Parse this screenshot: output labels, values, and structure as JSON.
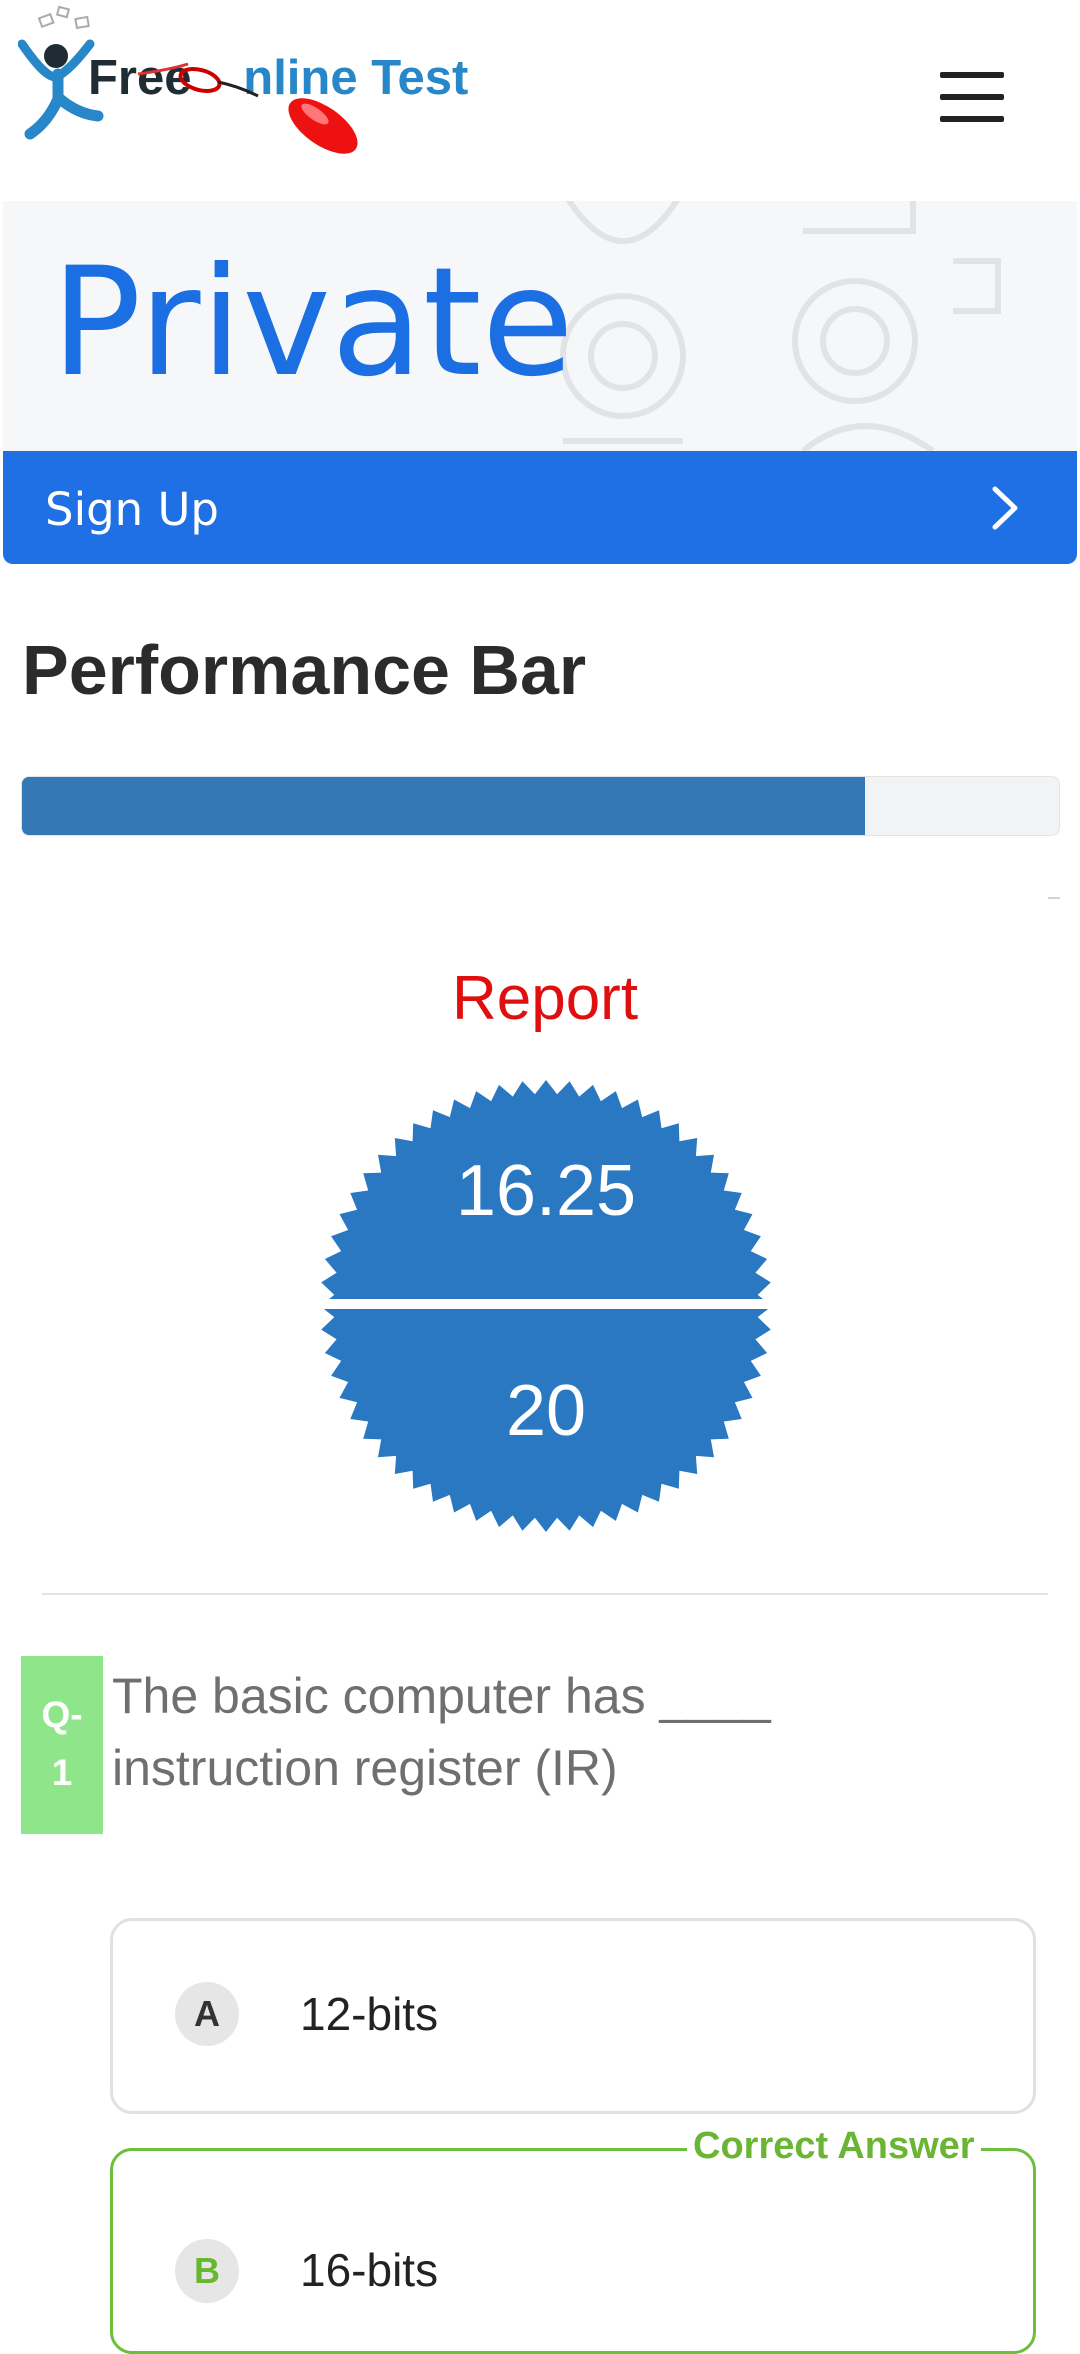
{
  "header": {
    "logo_word_free": "Free",
    "logo_word_o": "O",
    "logo_word_rest": "nline Test",
    "menu_icon": "hamburger-menu-icon"
  },
  "ad": {
    "headline": "Private",
    "cta_label": "Sign Up",
    "cta_icon": "chevron-right-icon"
  },
  "performance": {
    "title": "Performance Bar",
    "progress_fraction": 0.8125
  },
  "report": {
    "title": "Report",
    "score_obtained": "16.25",
    "score_total": "20"
  },
  "question": {
    "number_prefix": "Q-",
    "number": "1",
    "text": "The basic computer has ____ instruction register (IR)",
    "options": [
      {
        "letter": "A",
        "label": "12-bits"
      },
      {
        "letter": "B",
        "label": "16-bits",
        "tag": "Correct Answer"
      }
    ]
  },
  "colors": {
    "primary_blue": "#2a78c2",
    "ad_blue": "#1f6fe5",
    "report_red": "#e00f0f",
    "question_badge_green": "#8fe68a",
    "correct_green": "#6ab533"
  }
}
